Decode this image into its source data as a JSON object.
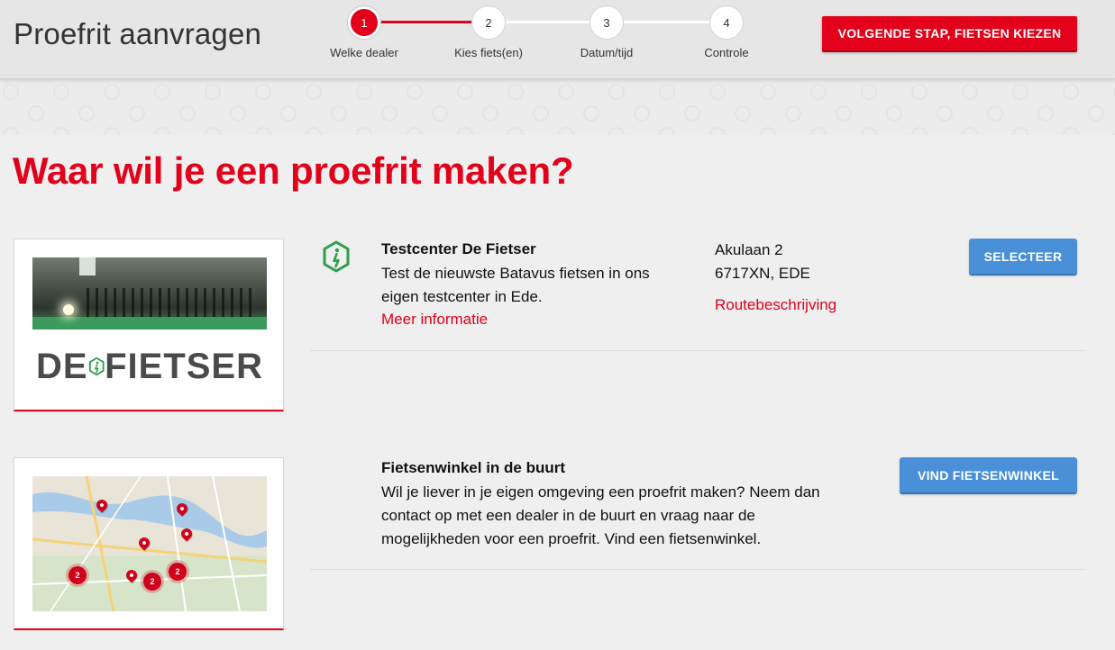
{
  "header": {
    "title": "Proefrit aanvragen",
    "next_button_label": "VOLGENDE STAP, FIETSEN KIEZEN",
    "steps": [
      {
        "number": "1",
        "label": "Welke dealer",
        "active": true
      },
      {
        "number": "2",
        "label": "Kies fiets(en)",
        "active": false
      },
      {
        "number": "3",
        "label": "Datum/tijd",
        "active": false
      },
      {
        "number": "4",
        "label": "Controle",
        "active": false
      }
    ]
  },
  "main": {
    "heading": "Waar wil je een proefrit maken?"
  },
  "dealer": {
    "logo_text_left": "DE",
    "logo_text_right": "FIETSER",
    "name": "Testcenter De Fietser",
    "description_line1": "Test de nieuwste Batavus fietsen in ons",
    "description_line2": "eigen testcenter in Ede.",
    "more_info_link": "Meer informatie",
    "address_street": "Akulaan 2",
    "address_city": "6717XN, EDE",
    "route_link": "Routebeschrijving",
    "select_button": "SELECTEER"
  },
  "nearby": {
    "title": "Fietsenwinkel in de buurt",
    "text_line1": "Wil je liever in je eigen omgeving een proefrit maken? Neem dan",
    "text_line2": "contact op met een dealer in de buurt en vraag naar de",
    "text_line3": "mogelijkheden voor een proefrit. Vind een fietsenwinkel.",
    "find_button": "VIND FIETSENWINKEL",
    "clusters": [
      "2",
      "2",
      "2"
    ]
  },
  "colors": {
    "brand_red": "#e2001a",
    "button_blue": "#4a90d9",
    "logo_green": "#2e9e4a"
  }
}
